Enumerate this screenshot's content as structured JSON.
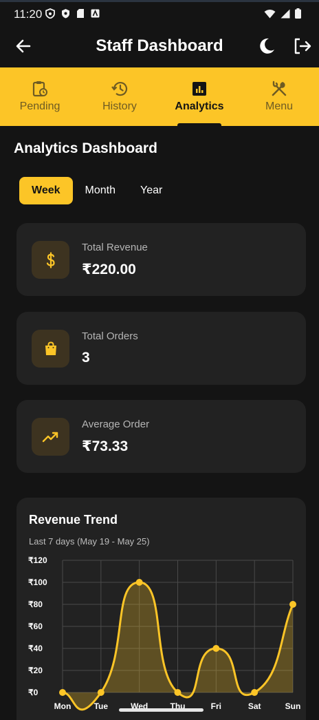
{
  "status_bar": {
    "time": "11:20",
    "left_icons": [
      "shield-notification-icon",
      "security-icon",
      "sd-card-icon",
      "app-notification-icon"
    ],
    "right_icons": [
      "wifi-icon",
      "signal-icon",
      "battery-icon"
    ]
  },
  "app_bar": {
    "title": "Staff Dashboard",
    "back_icon": "arrow-left-icon",
    "theme_icon": "moon-icon",
    "logout_icon": "logout-icon"
  },
  "tabs": [
    {
      "label": "Pending",
      "icon": "clipboard-clock-icon",
      "active": false
    },
    {
      "label": "History",
      "icon": "history-icon",
      "active": false
    },
    {
      "label": "Analytics",
      "icon": "bar-chart-icon",
      "active": true
    },
    {
      "label": "Menu",
      "icon": "utensils-icon",
      "active": false
    }
  ],
  "main": {
    "title": "Analytics Dashboard",
    "periods": [
      {
        "label": "Week",
        "active": true
      },
      {
        "label": "Month",
        "active": false
      },
      {
        "label": "Year",
        "active": false
      }
    ],
    "stats": [
      {
        "label": "Total Revenue",
        "value": "₹220.00",
        "icon": "dollar-icon"
      },
      {
        "label": "Total Orders",
        "value": "3",
        "icon": "shopping-bag-icon"
      },
      {
        "label": "Average Order",
        "value": "₹73.33",
        "icon": "trending-up-icon"
      }
    ]
  },
  "colors": {
    "accent": "#fcc527",
    "background": "#141414",
    "card": "#222222"
  },
  "chart_data": {
    "type": "area",
    "title": "Revenue Trend",
    "subtitle": "Last 7 days (May 19 - May 25)",
    "categories": [
      "Mon",
      "Tue",
      "Wed",
      "Thu",
      "Fri",
      "Sat",
      "Sun"
    ],
    "values": [
      0,
      0,
      100,
      0,
      40,
      0,
      80
    ],
    "ytick_labels": [
      "₹120",
      "₹100",
      "₹80",
      "₹60",
      "₹40",
      "₹20",
      "₹0"
    ],
    "yticks": [
      120,
      100,
      80,
      60,
      40,
      20,
      0
    ],
    "ylim": [
      0,
      120
    ],
    "grid": true
  }
}
